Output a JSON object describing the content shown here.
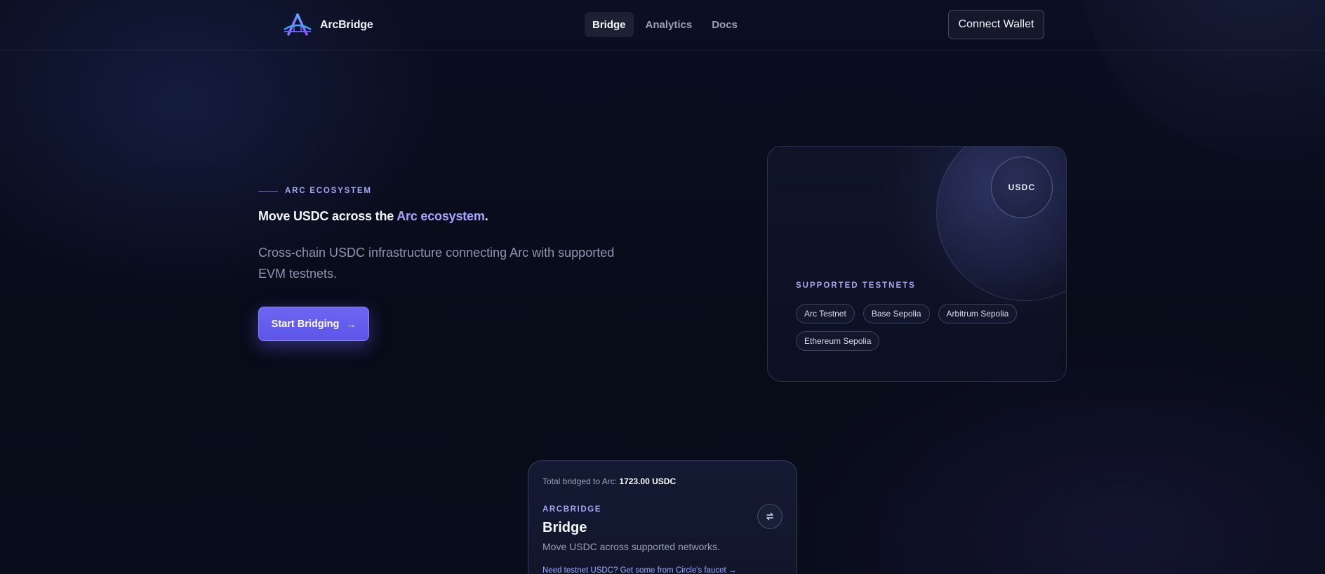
{
  "header": {
    "brand_name": "ArcBridge",
    "nav": [
      {
        "label": "Bridge",
        "active": true
      },
      {
        "label": "Analytics",
        "active": false
      },
      {
        "label": "Docs",
        "active": false
      }
    ],
    "connect_label": "Connect Wallet"
  },
  "hero": {
    "eyebrow": "ARC ECOSYSTEM",
    "headline_prefix": "Move USDC across the ",
    "headline_accent": "Arc ecosystem",
    "headline_suffix": ".",
    "subtext": "Cross-chain USDC infrastructure connecting Arc with supported EVM testnets.",
    "cta_label": "Start Bridging",
    "cta_icon": "arrow-right-icon"
  },
  "testnets_card": {
    "badge": "USDC",
    "title": "SUPPORTED TESTNETS",
    "chips": [
      "Arc Testnet",
      "Base Sepolia",
      "Arbitrum Sepolia",
      "Ethereum Sepolia"
    ]
  },
  "bridge_card": {
    "total_label": "Total bridged to Arc:",
    "total_value": "1723.00 USDC",
    "eyebrow": "ARCBRIDGE",
    "title": "Bridge",
    "subtitle": "Move USDC across supported networks.",
    "faucet_link": "Need testnet USDC? Get some from Circle's faucet →",
    "swap_icon": "swap-icon"
  },
  "colors": {
    "accent": "#a8a6ff",
    "cta": "#6d65f2",
    "background": "#080b18"
  }
}
